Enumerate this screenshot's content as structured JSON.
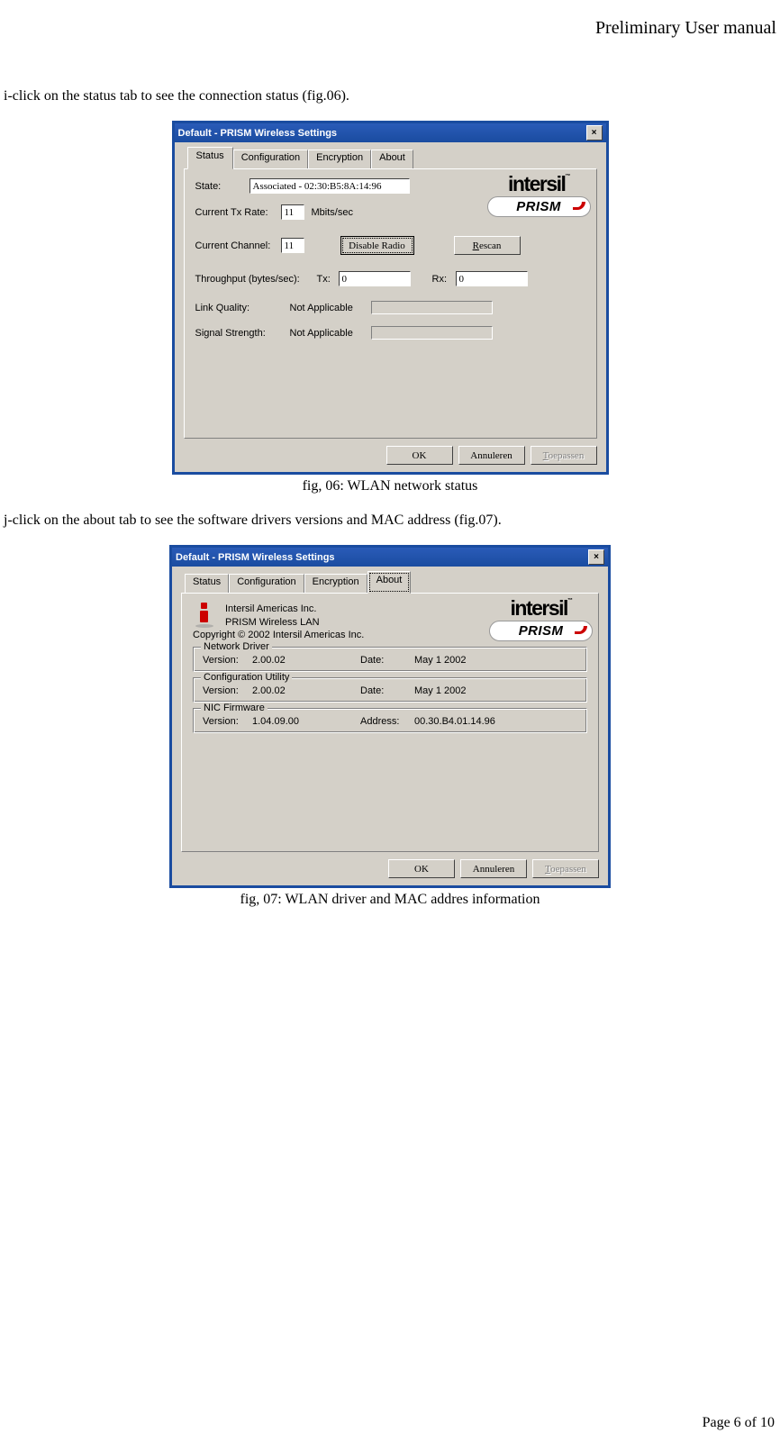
{
  "header": "Preliminary User manual",
  "footer": "Page 6 of 10",
  "text_i": "i-click on the status tab to see the connection status (fig.06).",
  "text_j": "j-click on the about tab to see the software drivers versions and MAC address (fig.07).",
  "caption1": "fig, 06: WLAN network status",
  "caption2": "fig, 07: WLAN driver and MAC addres information",
  "logo": {
    "intersil": "intersil",
    "prism": "PRISM"
  },
  "win1": {
    "title": "Default - PRISM Wireless Settings",
    "tabs": {
      "status": "Status",
      "config": "Configuration",
      "encrypt": "Encryption",
      "about": "About"
    },
    "state_lbl": "State:",
    "state_val": "Associated - 02:30:B5:8A:14:96",
    "txrate_lbl": "Current Tx Rate:",
    "txrate_val": "11",
    "txrate_unit": "Mbits/sec",
    "channel_lbl": "Current Channel:",
    "channel_val": "11",
    "disable_btn": "Disable Radio",
    "rescan_btn": "escan",
    "rescan_u": "R",
    "throughput_lbl": "Throughput (bytes/sec):",
    "tx_lbl": "Tx:",
    "tx_val": "0",
    "rx_lbl": "Rx:",
    "rx_val": "0",
    "link_lbl": "Link Quality:",
    "link_val": "Not Applicable",
    "signal_lbl": "Signal Strength:",
    "signal_val": "Not Applicable",
    "ok": "OK",
    "cancel": "Annuleren",
    "apply": "oepassen",
    "apply_u": "T"
  },
  "win2": {
    "title": "Default - PRISM Wireless Settings",
    "tabs": {
      "status": "Status",
      "config": "Configuration",
      "encrypt": "Encryption",
      "about": "About"
    },
    "company": "Intersil Americas Inc.",
    "product": "PRISM Wireless LAN",
    "copyright": "Copyright © 2002  Intersil Americas Inc.",
    "grp_net": "Network Driver",
    "grp_cfg": "Configuration Utility",
    "grp_nic": "NIC Firmware",
    "ver_lbl": "Version:",
    "date_lbl": "Date:",
    "addr_lbl": "Address:",
    "net_ver": "2.00.02",
    "net_date": "May  1 2002",
    "cfg_ver": "2.00.02",
    "cfg_date": "May  1 2002",
    "nic_ver": "1.04.09.00",
    "nic_addr": "00.30.B4.01.14.96",
    "ok": "OK",
    "cancel": "Annuleren",
    "apply": "oepassen",
    "apply_u": "T"
  }
}
